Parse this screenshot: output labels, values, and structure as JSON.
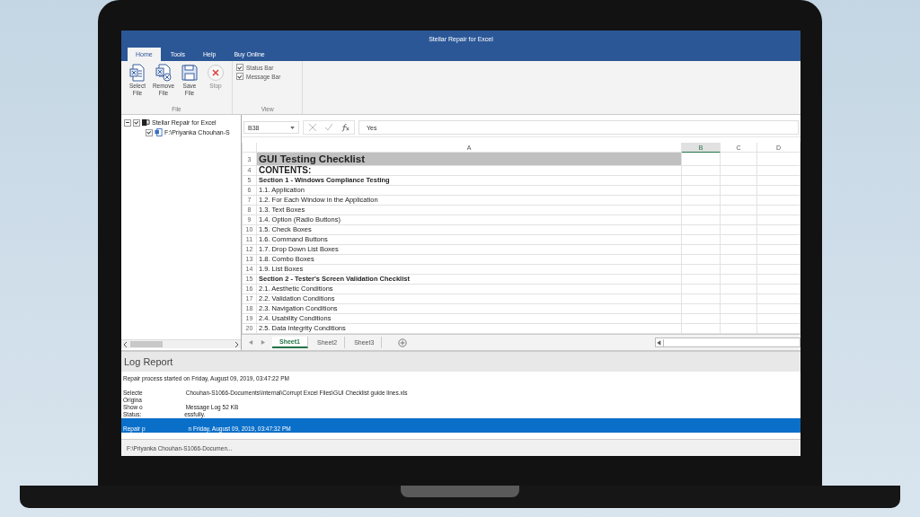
{
  "window": {
    "title": "Stellar Repair for Excel"
  },
  "tabs": [
    {
      "label": "Home",
      "selected": true
    },
    {
      "label": "Tools",
      "selected": false
    },
    {
      "label": "Help",
      "selected": false
    },
    {
      "label": "Buy Online",
      "selected": false
    }
  ],
  "ribbon": {
    "file_group": {
      "label": "File",
      "buttons": [
        {
          "kind": "select",
          "label": "Select File",
          "disabled": false
        },
        {
          "kind": "remove",
          "label": "Remove File",
          "disabled": false
        },
        {
          "kind": "save",
          "label": "Save File",
          "disabled": false
        },
        {
          "kind": "stop",
          "label": "Stop",
          "disabled": true
        }
      ]
    },
    "view_group": {
      "label": "View",
      "options": [
        {
          "label": "Status Bar",
          "checked": true
        },
        {
          "label": "Message Bar",
          "checked": true
        }
      ]
    }
  },
  "tree": {
    "label": "Stellar Repair for Excel",
    "checked": true,
    "expanded": true,
    "children": [
      {
        "label": "F:\\Priyanka Chouhan-S",
        "checked": true
      }
    ]
  },
  "spreadsheet": {
    "name_box": "B38",
    "formula": "Yes",
    "columns": [
      {
        "label": "A",
        "selected": false
      },
      {
        "label": "B",
        "selected": true
      },
      {
        "label": "C",
        "selected": false
      },
      {
        "label": "D",
        "selected": false
      }
    ],
    "rows": [
      {
        "number": "3",
        "text": "GUI Testing Checklist",
        "kind": "title"
      },
      {
        "number": "4",
        "text": "CONTENTS:",
        "kind": "heading"
      },
      {
        "number": "5",
        "text": "Section 1 - Windows Compliance Testing",
        "kind": "section"
      },
      {
        "number": "6",
        "text": "1.1. Application",
        "kind": "item"
      },
      {
        "number": "7",
        "text": "1.2. For Each Window in the Application",
        "kind": "item"
      },
      {
        "number": "8",
        "text": "1.3. Text Boxes",
        "kind": "item"
      },
      {
        "number": "9",
        "text": "1.4. Option (Radio Buttons)",
        "kind": "item"
      },
      {
        "number": "10",
        "text": "1.5. Check Boxes",
        "kind": "item"
      },
      {
        "number": "11",
        "text": "1.6. Command Buttons",
        "kind": "item"
      },
      {
        "number": "12",
        "text": "1.7. Drop Down List Boxes",
        "kind": "item"
      },
      {
        "number": "13",
        "text": "1.8. Combo Boxes",
        "kind": "item"
      },
      {
        "number": "14",
        "text": "1.9. List Boxes",
        "kind": "item"
      },
      {
        "number": "15",
        "text": "Section 2 - Tester's Screen Validation Checklist",
        "kind": "section"
      },
      {
        "number": "16",
        "text": "2.1. Aesthetic Conditions",
        "kind": "item"
      },
      {
        "number": "17",
        "text": "2.2. Validation Conditions",
        "kind": "item"
      },
      {
        "number": "18",
        "text": "2.3. Navigation Conditions",
        "kind": "item"
      },
      {
        "number": "19",
        "text": "2.4. Usability Conditions",
        "kind": "item"
      },
      {
        "number": "20",
        "text": "2.5. Data Integrity Conditions",
        "kind": "item"
      }
    ],
    "sheets": [
      {
        "label": "Sheet1",
        "selected": true
      },
      {
        "label": "Sheet2",
        "selected": false
      },
      {
        "label": "Sheet3",
        "selected": false
      }
    ]
  },
  "log": {
    "title": "Log Report",
    "lines": [
      {
        "parts": [
          "Repair process started on  Friday, August 09, 2019, 03:47:22 PM"
        ],
        "gap_before": false,
        "selected": false
      },
      {
        "parts": [
          "Selecte",
          "Chouhan-S1066-Documents\\Internal\\Corrupt Excel Files\\GUI Checklist guide lines.xls"
        ],
        "gap_before": true,
        "selected": false
      },
      {
        "parts": [
          "Origina"
        ],
        "gap_before": false,
        "selected": false
      },
      {
        "parts": [
          "Show o",
          "Message Log 52 KB"
        ],
        "gap_before": false,
        "selected": false
      },
      {
        "parts": [
          "Status:",
          "essfully."
        ],
        "gap_before": false,
        "selected": false
      },
      {
        "parts": [
          "Repair p",
          "n Friday, August 09, 2019, 03:47:32 PM"
        ],
        "gap_before": true,
        "selected": true
      }
    ]
  },
  "status_bar": {
    "text": "F:\\Priyanka Chouhan-S1066-Documen..."
  }
}
